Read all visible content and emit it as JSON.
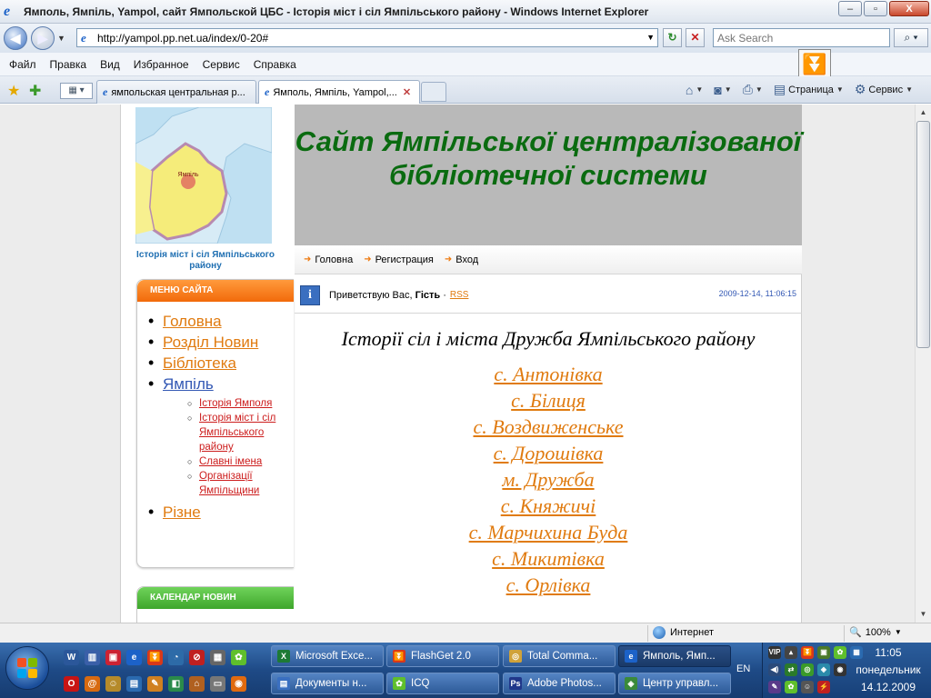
{
  "window": {
    "title": "Ямполь, Ямпіль, Yampol, сайт Ямпольской ЦБС - Історія міст і сіл Ямпільського району - Windows Internet Explorer",
    "minimize": "–",
    "maximize": "▫",
    "close": "X"
  },
  "address": {
    "url": "http://yampol.pp.net.ua/index/0-20#",
    "search_placeholder": "Ask Search"
  },
  "menu": [
    "Файл",
    "Правка",
    "Вид",
    "Избранное",
    "Сервис",
    "Справка"
  ],
  "tabs": [
    {
      "label": "ямпольская центральная р..."
    },
    {
      "label": "Ямполь, Ямпіль, Yampol,..."
    }
  ],
  "commandbar": {
    "page_label": "Страница",
    "tools_label": "Сервис"
  },
  "site": {
    "map_caption": "Історія міст і сіл Ямпільського району",
    "menu_header": "МЕНЮ САЙТА",
    "menu_items": [
      {
        "label": "Головна"
      },
      {
        "label": "Розділ Новин"
      },
      {
        "label": "Бібліотека"
      },
      {
        "label": "Ямпіль"
      },
      {
        "label": "Різне"
      }
    ],
    "submenu_items": [
      {
        "label": "Історія Ямполя"
      },
      {
        "label": "Історія міст і сіл Ямпільського району"
      },
      {
        "label": "Славні імена"
      },
      {
        "label": "Організації Ямпільщини"
      }
    ],
    "calendar_header": "КАЛЕНДАР НОВИН",
    "banner_title": "Сайт Ямпільської централізованої бібліотечної системи",
    "top_nav": [
      "Головна",
      "Регистрация",
      "Вход"
    ],
    "greeting_prefix": "Приветствую Вас,",
    "greeting_user": "Гість",
    "greeting_separator": "·",
    "rss_label": "RSS",
    "datetime": "2009-12-14, 11:06:15",
    "article_title": "Історії сіл і міста Дружба Ямпільського району",
    "villages": [
      "с. Антонівка",
      "с. Білиця",
      "с. Воздвиженське",
      "с. Дорошівка",
      "м. Дружба",
      "с. Княжичі",
      "с. Марчихина Буда",
      "с. Микитівка",
      "с. Орлівка"
    ]
  },
  "status": {
    "zone": "Интернет",
    "zoom": "100%"
  },
  "taskbar": {
    "buttons": [
      {
        "label": "Microsoft Exce...",
        "icon_color": "#1d7a35"
      },
      {
        "label": "FlashGet 2.0",
        "icon_color": "#d8381a"
      },
      {
        "label": "Total Comma...",
        "icon_color": "#d0a23a"
      },
      {
        "label": "Ямполь, Ямп...",
        "icon_color": "#1c62c8"
      },
      {
        "label": "Документы н...",
        "icon_color": "#3a6fc0"
      },
      {
        "label": "ICQ",
        "icon_color": "#5fbf2c"
      },
      {
        "label": "Adobe Photos...",
        "icon_color": "#20378a"
      },
      {
        "label": "Центр управл...",
        "icon_color": "#3a8a3a"
      }
    ],
    "language": "EN",
    "time": "11:05",
    "day": "понедельник",
    "date": "14.12.2009"
  }
}
